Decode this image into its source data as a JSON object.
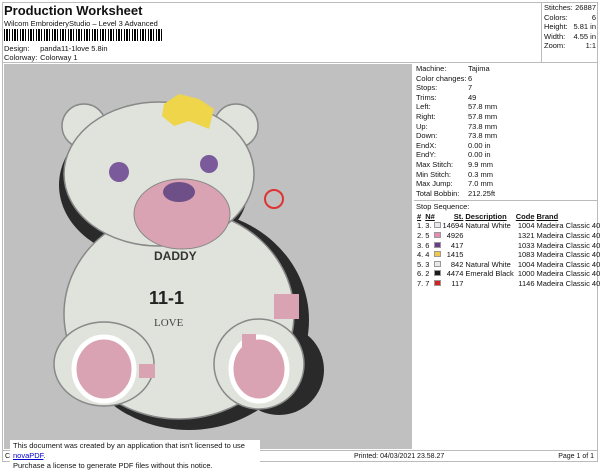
{
  "header": {
    "title": "Production Worksheet",
    "subtitle": "Wilcom EmbroideryStudio – Level 3 Advanced",
    "design_label": "Design:",
    "design": "panda11-1love 5.8in",
    "colorway_label": "Colorway:",
    "colorway": "Colorway 1"
  },
  "stats": [
    {
      "k": "Stitches:",
      "v": "26887"
    },
    {
      "k": "Colors:",
      "v": "6"
    },
    {
      "k": "Height:",
      "v": "5.81 in"
    },
    {
      "k": "Width:",
      "v": "4.55 in"
    },
    {
      "k": "Zoom:",
      "v": "1:1"
    }
  ],
  "details": [
    {
      "k": "Machine:",
      "v": "Tajima"
    },
    {
      "k": "Color changes:",
      "v": "6"
    },
    {
      "k": "Stops:",
      "v": "7"
    },
    {
      "k": "Trims:",
      "v": "49"
    },
    {
      "k": "Left:",
      "v": "57.8 mm"
    },
    {
      "k": "Right:",
      "v": "57.8 mm"
    },
    {
      "k": "Up:",
      "v": "73.8 mm"
    },
    {
      "k": "Down:",
      "v": "73.8 mm"
    },
    {
      "k": "EndX:",
      "v": "0.00 in"
    },
    {
      "k": "EndY:",
      "v": "0.00 in"
    },
    {
      "k": "Max Stitch:",
      "v": "9.9 mm"
    },
    {
      "k": "Min Stitch:",
      "v": "0.3 mm"
    },
    {
      "k": "Max Jump:",
      "v": "7.0 mm"
    },
    {
      "k": "Total Bobbin:",
      "v": "212.25ft"
    }
  ],
  "stop_sequence": {
    "title": "Stop Sequence:",
    "headers": [
      "#",
      "N#",
      "St.",
      "Description",
      "Code",
      "Brand"
    ],
    "rows": [
      {
        "n": "1.",
        "nn": "3.",
        "color": "#e8e8ee",
        "st": "14694",
        "desc": "Natural White",
        "code": "1004",
        "brand": "Madeira Classic 40"
      },
      {
        "n": "2.",
        "nn": "5",
        "color": "#e68ab4",
        "st": "4926",
        "desc": "",
        "code": "1321",
        "brand": "Madeira Classic 40"
      },
      {
        "n": "3.",
        "nn": "6",
        "color": "#6a3d8c",
        "st": "417",
        "desc": "",
        "code": "1033",
        "brand": "Madeira Classic 40"
      },
      {
        "n": "4.",
        "nn": "4",
        "color": "#f2c84a",
        "st": "1415",
        "desc": "",
        "code": "1083",
        "brand": "Madeira Classic 40"
      },
      {
        "n": "5.",
        "nn": "3",
        "color": "#e8e8ee",
        "st": "842",
        "desc": "Natural White",
        "code": "1004",
        "brand": "Madeira Classic 40"
      },
      {
        "n": "6.",
        "nn": "2",
        "color": "#1a1a1a",
        "st": "4474",
        "desc": "Emerald Black",
        "code": "1000",
        "brand": "Madeira Classic 40"
      },
      {
        "n": "7.",
        "nn": "7",
        "color": "#d42020",
        "st": "117",
        "desc": "",
        "code": "1146",
        "brand": "Madeira Classic 40"
      }
    ]
  },
  "footer": {
    "created": "Cr",
    "printed": "Printed: 04/03/2021 23.58.27",
    "page": "Page 1 of 1"
  },
  "notice": {
    "line1": "This document was created by an application that isn't licensed to use ",
    "link": "novaPDF",
    "line1_end": ".",
    "line2": "Purchase a license to generate PDF files without this notice."
  },
  "design_text": {
    "daddy": "DADDY",
    "number": "11-1",
    "love": "LOVE"
  }
}
